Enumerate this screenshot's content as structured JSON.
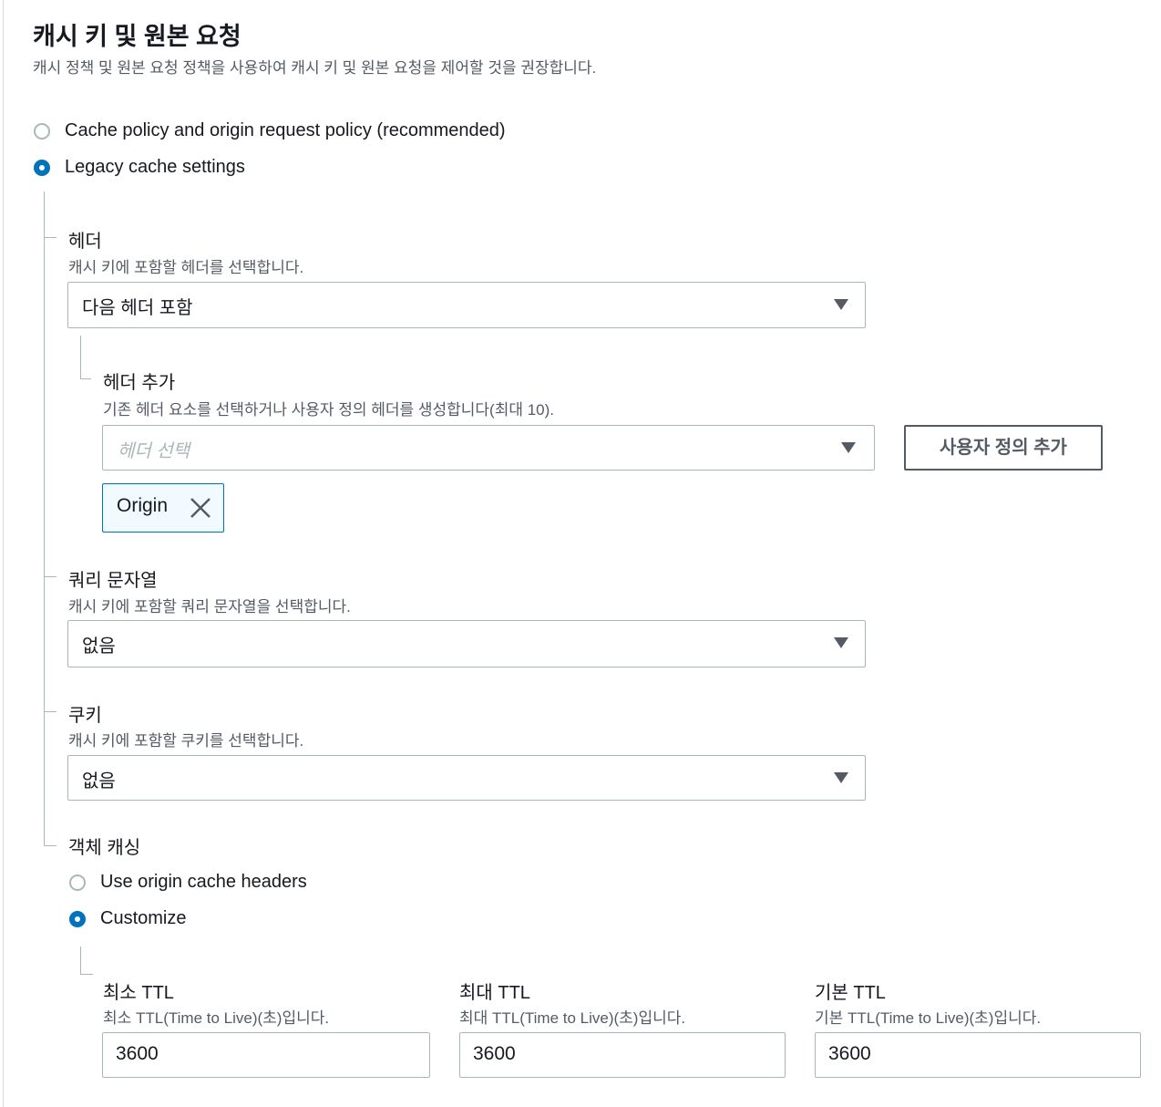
{
  "section": {
    "title": "캐시 키 및 원본 요청",
    "description": "캐시 정책 및 원본 요청 정책을 사용하여 캐시 키 및 원본 요청을 제어할 것을 권장합니다."
  },
  "mode_options": [
    {
      "label": "Cache policy and origin request policy (recommended)",
      "selected": false
    },
    {
      "label": "Legacy cache settings",
      "selected": true
    }
  ],
  "headers": {
    "label": "헤더",
    "description": "캐시 키에 포함할 헤더를 선택합니다.",
    "selected": "다음 헤더 포함",
    "add": {
      "label": "헤더 추가",
      "description": "기존 헤더 요소를 선택하거나 사용자 정의 헤더를 생성합니다(최대 10).",
      "placeholder": "헤더 선택",
      "custom_button": "사용자 정의 추가",
      "tokens": [
        "Origin"
      ]
    }
  },
  "query_strings": {
    "label": "쿼리 문자열",
    "description": "캐시 키에 포함할 쿼리 문자열을 선택합니다.",
    "selected": "없음"
  },
  "cookies": {
    "label": "쿠키",
    "description": "캐시 키에 포함할 쿠키를 선택합니다.",
    "selected": "없음"
  },
  "object_caching": {
    "label": "객체 캐싱",
    "options": [
      {
        "label": "Use origin cache headers",
        "selected": false
      },
      {
        "label": "Customize",
        "selected": true
      }
    ],
    "ttl": [
      {
        "label": "최소 TTL",
        "description": "최소 TTL(Time to Live)(초)입니다.",
        "value": "3600"
      },
      {
        "label": "최대 TTL",
        "description": "최대 TTL(Time to Live)(초)입니다.",
        "value": "3600"
      },
      {
        "label": "기본 TTL",
        "description": "기본 TTL(Time to Live)(초)입니다.",
        "value": "3600"
      }
    ]
  },
  "colors": {
    "accent": "#0073bb",
    "border": "#aab7b8",
    "secondary_text": "#545b64"
  }
}
